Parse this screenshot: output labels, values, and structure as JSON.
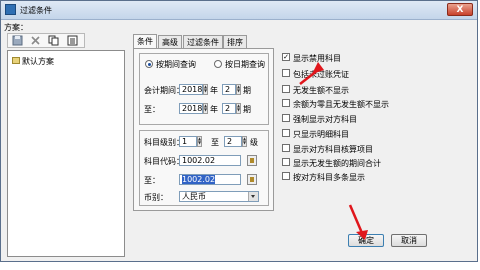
{
  "window": {
    "title": "过滤条件",
    "close_label": "X"
  },
  "left": {
    "scheme_label": "方案：",
    "tree_items": [
      "默认方案"
    ]
  },
  "tabs": [
    {
      "label": "条件"
    },
    {
      "label": "高级"
    },
    {
      "label": "过滤条件"
    },
    {
      "label": "排序"
    }
  ],
  "conditions": {
    "query_by_period": "按期间查询",
    "query_by_date": "按日期查询",
    "accounting_period": "会计期间：",
    "to": "至：",
    "year_unit": "年",
    "period_unit": "期",
    "start_year": "2018",
    "start_period": "2",
    "end_year": "2018",
    "end_period": "2",
    "account_level": "科目级别：",
    "level_from": "1",
    "level_to_label": "至",
    "level_to": "2",
    "level_unit": "级",
    "account_code": "科目代码：",
    "account_code_from": "1002.02",
    "account_code_to_label": "至：",
    "account_code_to": "1002.02",
    "currency_label": "币别：",
    "currency_value": "人民币"
  },
  "options": [
    {
      "label": "显示禁用科目",
      "checked": true
    },
    {
      "label": "包括未过账凭证",
      "checked": false
    },
    {
      "label": "无发生额不显示",
      "checked": false
    },
    {
      "label": "余额为零且无发生额不显示",
      "checked": false
    },
    {
      "label": "强制显示对方科目",
      "checked": false
    },
    {
      "label": "只显示明细科目",
      "checked": false
    },
    {
      "label": "显示对方科目核算项目",
      "checked": false
    },
    {
      "label": "显示无发生额的期间合计",
      "checked": false
    },
    {
      "label": "按对方科目多条显示",
      "checked": false
    }
  ],
  "buttons": {
    "ok": "确定",
    "cancel": "取消"
  },
  "colors": {
    "accent": "#3163c6",
    "annotation_arrow": "#e0161c"
  }
}
